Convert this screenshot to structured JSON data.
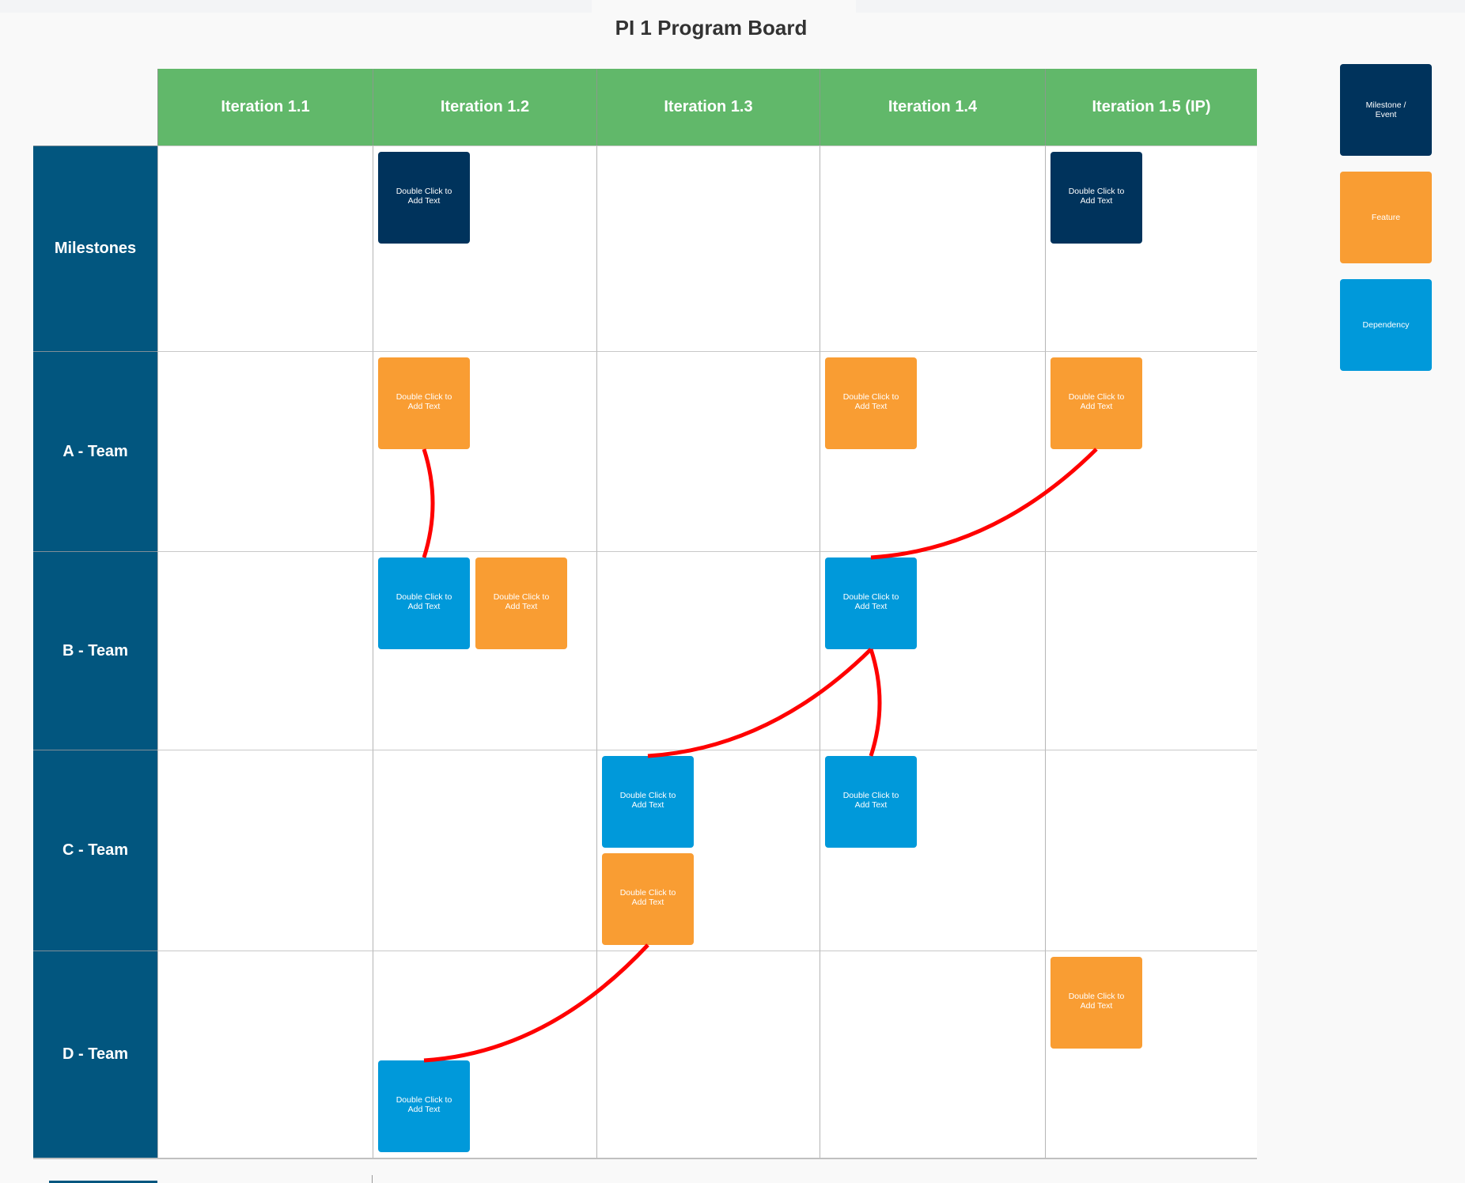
{
  "title": "PI 1 Program Board",
  "colors": {
    "header_green": "#61b86a",
    "row_header_blue": "#02567f",
    "milestone": "#00335c",
    "feature": "#f99d33",
    "dependency": "#0099da",
    "dependency_link": "#ff0000"
  },
  "iterations": [
    {
      "label": "Iteration 1.1"
    },
    {
      "label": "Iteration 1.2"
    },
    {
      "label": "Iteration 1.3"
    },
    {
      "label": "Iteration 1.4"
    },
    {
      "label": "Iteration 1.5  (IP)"
    }
  ],
  "rows": [
    {
      "label": "Milestones"
    },
    {
      "label": "A - Team"
    },
    {
      "label": "B - Team"
    },
    {
      "label": "C - Team"
    },
    {
      "label": "D - Team"
    }
  ],
  "cards": [
    {
      "id": "m1",
      "type": "milestone",
      "row": 0,
      "iteration": 1,
      "text": "Double Click to Add Text"
    },
    {
      "id": "m2",
      "type": "milestone",
      "row": 0,
      "iteration": 4,
      "text": "Double Click to Add Text"
    },
    {
      "id": "a1",
      "type": "feature",
      "row": 1,
      "iteration": 1,
      "text": "Double Click to Add Text"
    },
    {
      "id": "a2",
      "type": "feature",
      "row": 1,
      "iteration": 3,
      "text": "Double Click to Add Text"
    },
    {
      "id": "a3",
      "type": "feature",
      "row": 1,
      "iteration": 4,
      "text": "Double Click to Add Text"
    },
    {
      "id": "b1",
      "type": "dependency",
      "row": 2,
      "iteration": 1,
      "text": "Double Click to Add Text"
    },
    {
      "id": "b2",
      "type": "feature",
      "row": 2,
      "iteration": 1,
      "text": "Double Click to Add Text"
    },
    {
      "id": "b3",
      "type": "dependency",
      "row": 2,
      "iteration": 3,
      "text": "Double Click to Add Text"
    },
    {
      "id": "c1",
      "type": "dependency",
      "row": 3,
      "iteration": 2,
      "text": "Double Click to Add Text"
    },
    {
      "id": "c2",
      "type": "feature",
      "row": 3,
      "iteration": 2,
      "text": "Double Click to Add Text"
    },
    {
      "id": "c3",
      "type": "dependency",
      "row": 3,
      "iteration": 3,
      "text": "Double Click to Add Text"
    },
    {
      "id": "d1",
      "type": "dependency",
      "row": 4,
      "iteration": 1,
      "text": "Double Click to Add Text"
    },
    {
      "id": "d2",
      "type": "feature",
      "row": 4,
      "iteration": 4,
      "text": "Double Click to Add Text"
    }
  ],
  "links": [
    {
      "from": "a1",
      "to": "b1"
    },
    {
      "from": "a3",
      "to": "b3"
    },
    {
      "from": "b3",
      "to": "c1"
    },
    {
      "from": "b3",
      "to": "c3"
    },
    {
      "from": "c2",
      "to": "d1"
    }
  ],
  "legend": [
    {
      "type": "milestone",
      "label": "Milestone / Event"
    },
    {
      "type": "feature",
      "label": "Feature"
    },
    {
      "type": "dependency",
      "label": "Dependency"
    }
  ]
}
